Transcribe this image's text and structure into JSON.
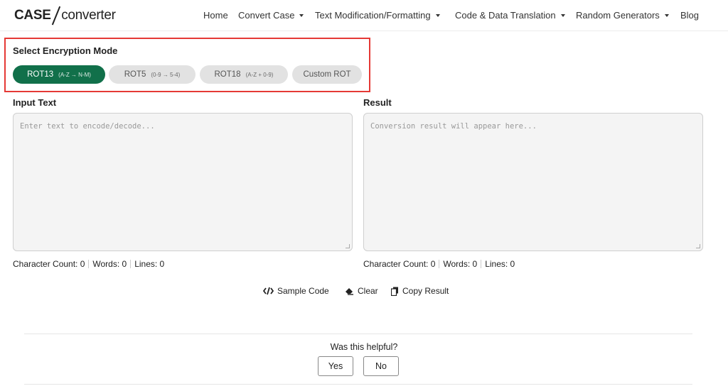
{
  "logo": {
    "part1": "CASE",
    "part2": "converter"
  },
  "nav": [
    {
      "label": "Home",
      "has_dropdown": false
    },
    {
      "label": "Convert Case",
      "has_dropdown": true
    },
    {
      "label": "Text Modification/Formatting",
      "has_dropdown": true
    },
    {
      "label": "Code & Data Translation",
      "has_dropdown": true
    },
    {
      "label": "Random Generators",
      "has_dropdown": true
    },
    {
      "label": "Blog",
      "has_dropdown": false
    }
  ],
  "mode": {
    "title": "Select Encryption Mode",
    "options": [
      {
        "label": "ROT13",
        "sub": "(A-Z → N-M)",
        "active": true
      },
      {
        "label": "ROT5",
        "sub": "(0-9 → 5-4)",
        "active": false
      },
      {
        "label": "ROT18",
        "sub": "(A-Z + 0-9)",
        "active": false
      },
      {
        "label": "Custom ROT",
        "sub": "",
        "active": false
      }
    ]
  },
  "input": {
    "label": "Input Text",
    "placeholder": "Enter text to encode/decode...",
    "stats": {
      "chars_label": "Character Count: 0",
      "words_label": "Words: 0",
      "lines_label": "Lines: 0"
    }
  },
  "result": {
    "label": "Result",
    "placeholder": "Conversion result will appear here...",
    "stats": {
      "chars_label": "Character Count: 0",
      "words_label": "Words: 0",
      "lines_label": "Lines: 0"
    }
  },
  "actions": {
    "sample": "Sample Code",
    "clear": "Clear",
    "copy": "Copy Result"
  },
  "feedback": {
    "question": "Was this helpful?",
    "yes": "Yes",
    "no": "No"
  },
  "colors": {
    "accent": "#11704a",
    "highlight_border": "#e53935",
    "inactive_btn": "#e2e2e2"
  }
}
